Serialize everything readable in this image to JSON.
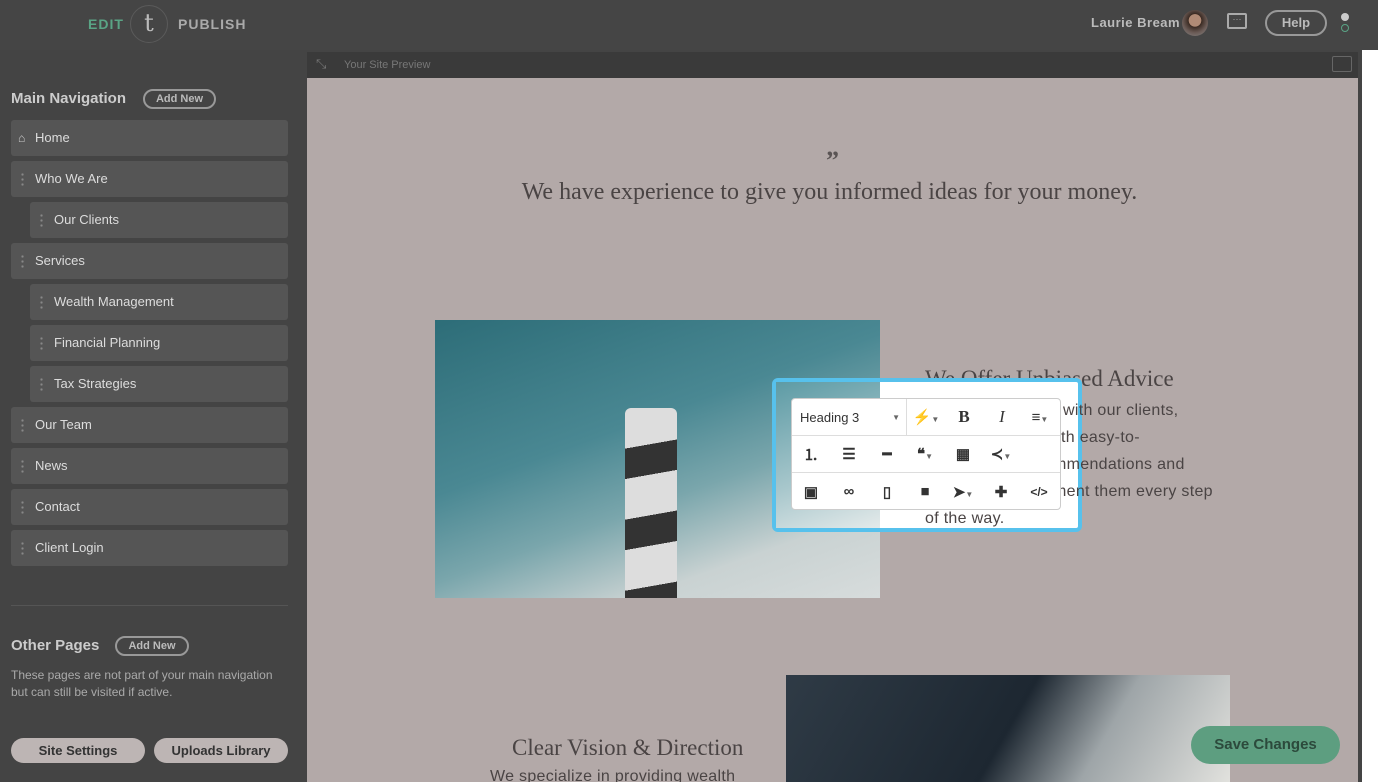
{
  "header": {
    "edit": "EDIT",
    "logo": "t",
    "publish": "PUBLISH",
    "user": "Laurie Bream",
    "help": "Help"
  },
  "sidebar": {
    "main_title": "Main Navigation",
    "add_new": "Add New",
    "items": [
      {
        "label": "Home",
        "level": 0,
        "icon": "home-icon"
      },
      {
        "label": "Who We Are",
        "level": 0
      },
      {
        "label": "Our Clients",
        "level": 1
      },
      {
        "label": "Services",
        "level": 0
      },
      {
        "label": "Wealth Management",
        "level": 1
      },
      {
        "label": "Financial Planning",
        "level": 1
      },
      {
        "label": "Tax Strategies",
        "level": 1
      },
      {
        "label": "Our Team",
        "level": 0
      },
      {
        "label": "News",
        "level": 0
      },
      {
        "label": "Contact",
        "level": 0
      },
      {
        "label": "Client Login",
        "level": 0
      }
    ],
    "other_title": "Other Pages",
    "other_add_new": "Add New",
    "other_desc": "These pages are not part of your main navigation but can still be visited if active.",
    "site_settings": "Site Settings",
    "uploads_library": "Uploads Library"
  },
  "preview": {
    "label": "Your Site Preview",
    "quote_mark": "”",
    "quote": "We have experience to give you informed ideas for your money.",
    "section1_heading": "We Offer Unbiased Advice",
    "section1_lines": [
      "with our clients,",
      "th easy-to-",
      "mmendations and",
      "ment them every step",
      "of the way."
    ],
    "section2_heading": "Clear Vision & Direction",
    "section2_text": "We specialize in providing wealth"
  },
  "toolbar": {
    "format": "Heading 3",
    "bold": "B",
    "italic": "I"
  },
  "save_changes": "Save Changes",
  "colors": {
    "accent": "#5aa485",
    "highlight": "#57c1ec",
    "save": "#5d9e80"
  }
}
